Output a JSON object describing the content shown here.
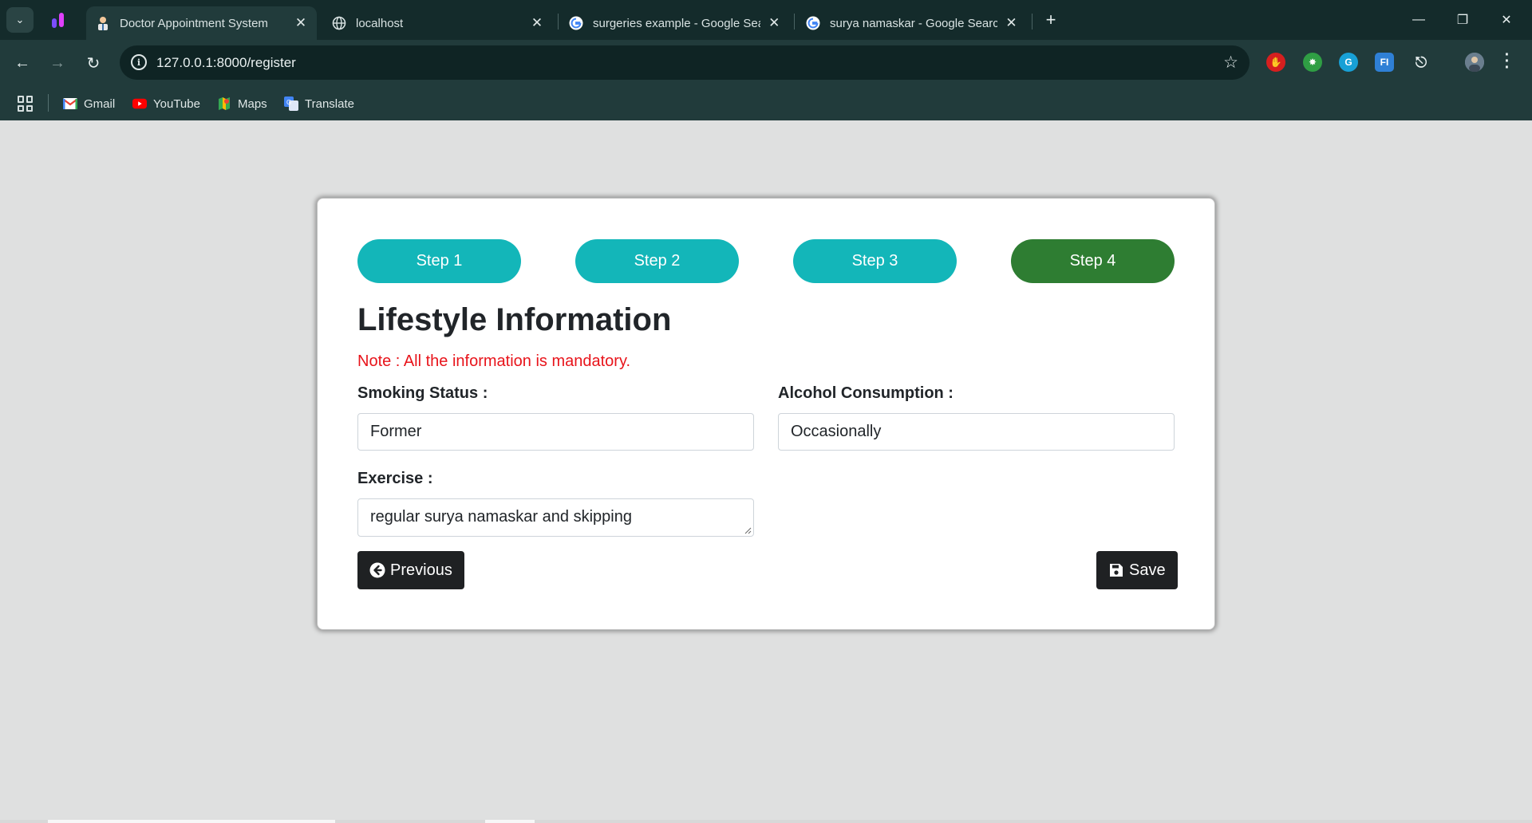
{
  "browser": {
    "tabs": [
      {
        "title": "Doctor Appointment System",
        "active": true
      },
      {
        "title": "localhost",
        "active": false
      },
      {
        "title": "surgeries example - Google Sea",
        "active": false
      },
      {
        "title": "surya namaskar - Google Search",
        "active": false
      }
    ],
    "url": "127.0.0.1:8000/register",
    "bookmarks": [
      "Gmail",
      "YouTube",
      "Maps",
      "Translate"
    ]
  },
  "steps": [
    "Step 1",
    "Step 2",
    "Step 3",
    "Step 4"
  ],
  "current_step": 4,
  "form": {
    "heading": "Lifestyle Information",
    "note": "Note : All the information is mandatory.",
    "smoking": {
      "label": "Smoking Status :",
      "value": "Former"
    },
    "alcohol": {
      "label": "Alcohol Consumption :",
      "value": "Occasionally"
    },
    "exercise": {
      "label": "Exercise :",
      "value": "regular surya namaskar and skipping"
    },
    "previous_label": "Previous",
    "save_label": "Save"
  },
  "colors": {
    "step_done": "#13b6b9",
    "step_current": "#2e7d32",
    "note": "#e8141b",
    "button": "#1f2123"
  }
}
